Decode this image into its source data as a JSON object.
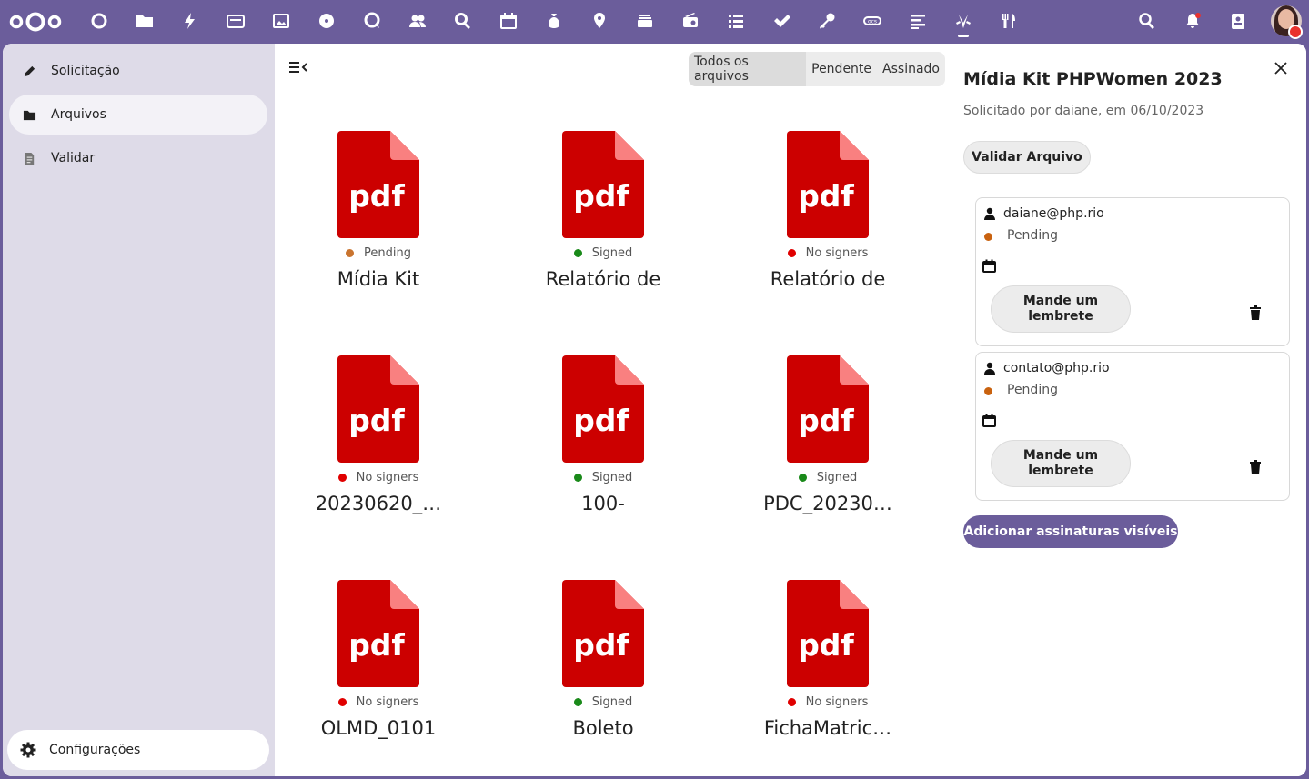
{
  "topbar": {
    "apps": [
      "dashboard-icon",
      "files-icon",
      "activity-icon",
      "mail-icon",
      "photos-icon",
      "music-icon",
      "talk-icon",
      "contacts-icon",
      "search-app-icon",
      "calendar-icon",
      "money-icon",
      "maps-icon",
      "deck-icon",
      "radio-icon",
      "tasks-icon",
      "check-icon",
      "passwords-icon",
      "ocs-icon",
      "notes-icon",
      "libresign-icon",
      "cookbook-icon"
    ],
    "right": [
      "unified-search-icon",
      "notifications-icon",
      "contacts-menu-icon",
      "user-avatar"
    ]
  },
  "sidebar": {
    "items": [
      {
        "label": "Solicitação",
        "icon": "pencil-icon"
      },
      {
        "label": "Arquivos",
        "icon": "folder-icon"
      },
      {
        "label": "Validar",
        "icon": "document-icon"
      }
    ],
    "settings_label": "Configurações"
  },
  "filters": {
    "all": "Todos os arquivos",
    "pending": "Pendente",
    "signed": "Assinado"
  },
  "files": [
    {
      "ext": "pdf",
      "status": "Pending",
      "status_color": "#c9742f",
      "name": "Mídia Kit"
    },
    {
      "ext": "pdf",
      "status": "Signed",
      "status_color": "#1a8a1a",
      "name": "Relatório de"
    },
    {
      "ext": "pdf",
      "status": "No signers",
      "status_color": "#e00000",
      "name": "Relatório de"
    },
    {
      "ext": "pdf",
      "status": "No signers",
      "status_color": "#e00000",
      "name": "20230620_…"
    },
    {
      "ext": "pdf",
      "status": "Signed",
      "status_color": "#1a8a1a",
      "name": "100-"
    },
    {
      "ext": "pdf",
      "status": "Signed",
      "status_color": "#1a8a1a",
      "name": "PDC_20230…"
    },
    {
      "ext": "pdf",
      "status": "No signers",
      "status_color": "#e00000",
      "name": "OLMD_0101"
    },
    {
      "ext": "pdf",
      "status": "Signed",
      "status_color": "#1a8a1a",
      "name": "Boleto"
    },
    {
      "ext": "pdf",
      "status": "No signers",
      "status_color": "#e00000",
      "name": "FichaMatric…"
    }
  ],
  "panel": {
    "title": "Mídia Kit PHPWomen 2023",
    "subtitle": "Solicitado por daiane, em 06/10/2023",
    "validate_label": "Validar Arquivo",
    "signers": [
      {
        "email": "daiane@php.rio",
        "status": "Pending",
        "remind_label": "Mande um lembrete"
      },
      {
        "email": "contato@php.rio",
        "status": "Pending",
        "remind_label": "Mande um lembrete"
      }
    ],
    "add_label": "Adicionar assinaturas visíveis"
  },
  "colors": {
    "brand": "#6b5d9b",
    "pdf_red": "#cc0000",
    "pdf_fold": "#f98080"
  }
}
